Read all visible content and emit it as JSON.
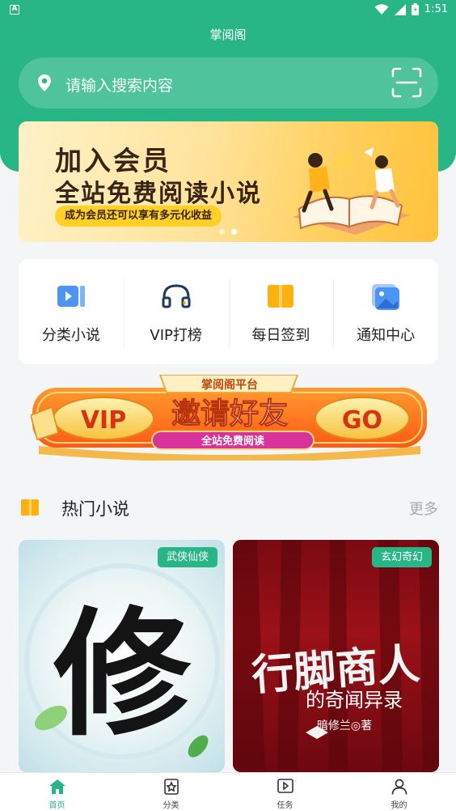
{
  "status_bar": {
    "time": "1:51",
    "notif_icon": "a-letter-icon"
  },
  "app": {
    "title": "掌阅阁"
  },
  "search": {
    "placeholder": "请输入搜索内容",
    "icons": [
      "location-pin-icon",
      "scan-icon"
    ]
  },
  "banner": {
    "headline": "加入会员",
    "subheadline": "全站免费阅读小说",
    "pill": "成为会员还可以享有多元化收益",
    "dots": 2,
    "active_dot": 1
  },
  "quick_actions": [
    {
      "label": "分类小说",
      "icon": "video-book-icon"
    },
    {
      "label": "VIP打榜",
      "icon": "headphones-icon"
    },
    {
      "label": "每日签到",
      "icon": "book-icon"
    },
    {
      "label": "通知中心",
      "icon": "image-card-icon"
    }
  ],
  "invite_banner": {
    "platform": "掌阅阁平台",
    "vip": "VIP",
    "main": "邀请好友",
    "go": "GO",
    "sub": "全站免费阅读"
  },
  "hot_section": {
    "title": "热门小说",
    "more": "更多"
  },
  "books": [
    {
      "tag": "武侠仙侠",
      "cover_text": "修"
    },
    {
      "tag": "玄幻奇幻",
      "cover_title": "行脚商人",
      "cover_subtitle": "的奇闻异录",
      "cover_author": "暗修兰◎著"
    }
  ],
  "tabs": [
    {
      "label": "首页",
      "icon": "home-icon",
      "active": true
    },
    {
      "label": "分类",
      "icon": "category-icon",
      "active": false
    },
    {
      "label": "任务",
      "icon": "play-task-icon",
      "active": false
    },
    {
      "label": "我的",
      "icon": "user-icon",
      "active": false
    }
  ],
  "colors": {
    "primary": "#29b686",
    "banner_yellow": "#ffcf5c",
    "invite_orange": "#ff7a1a",
    "text_dark": "#222222",
    "muted": "#aaaaaa"
  }
}
